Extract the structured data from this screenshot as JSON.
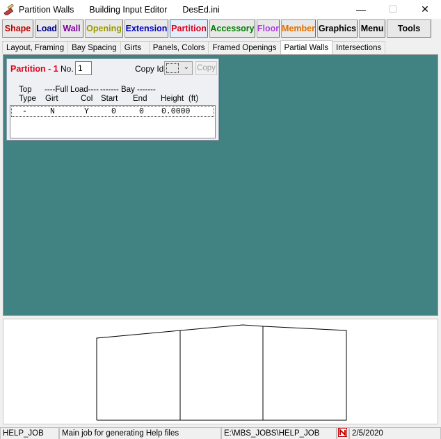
{
  "window": {
    "title_segments": [
      "Partition Walls",
      "Building Input Editor",
      "DesEd.ini"
    ],
    "icons": {
      "app": "pencil-ruler-icon",
      "minimize": "minimize-icon",
      "maximize": "maximize-icon",
      "close": "close-icon"
    },
    "controls": [
      "—",
      "☐",
      "✕"
    ]
  },
  "toolbar": {
    "buttons": [
      {
        "label": "Shape",
        "color": "#c00000"
      },
      {
        "label": "Load",
        "color": "#00008b"
      },
      {
        "label": "Wall",
        "color": "#7b0099"
      },
      {
        "label": "Opening",
        "color": "#9a9a00"
      },
      {
        "label": "Extension",
        "color": "#0000c0"
      },
      {
        "label": "Partition",
        "color": "#e0001b",
        "active": true
      },
      {
        "label": "Accessory",
        "color": "#008000"
      },
      {
        "label": "Floor",
        "color": "#b040e0"
      },
      {
        "label": "Member",
        "color": "#e07000"
      },
      {
        "label": "Graphics",
        "color": "#000000"
      },
      {
        "label": "Menu",
        "color": "#000000"
      },
      {
        "label": "Tools",
        "color": "#000000"
      }
    ]
  },
  "tabs": [
    {
      "label": "Layout, Framing"
    },
    {
      "label": "Bay Spacing"
    },
    {
      "label": "Girts"
    },
    {
      "label": "Panels, Colors"
    },
    {
      "label": "Framed Openings"
    },
    {
      "label": "Partial Walls",
      "active": true
    },
    {
      "label": "Intersections"
    }
  ],
  "panel": {
    "title": "Partition - 1",
    "no_label": "No.",
    "no_value": "1",
    "copy_id_label": "Copy Id",
    "copy_button": "Copy",
    "headers": {
      "top": "Top",
      "type": "Type",
      "full_load": "----Full Load----",
      "girt": "Girt",
      "col": "Col",
      "bay": "------- Bay -------",
      "start": "Start",
      "end": "End",
      "height": "Height",
      "height_unit": "(ft)"
    },
    "rows": [
      {
        "type": "-",
        "girt": "N",
        "col": "Y",
        "start": "0",
        "end": "0",
        "height": "0.0000"
      }
    ]
  },
  "statusbar": {
    "job": "HELP_JOB",
    "description": "Main job for generating Help files",
    "path": "E:\\MBS_JOBS\\HELP_JOB",
    "date": "2/5/2020",
    "icon": "n-logo-icon"
  },
  "colors": {
    "canvas": "#418382",
    "partition_title": "#e0001b"
  }
}
